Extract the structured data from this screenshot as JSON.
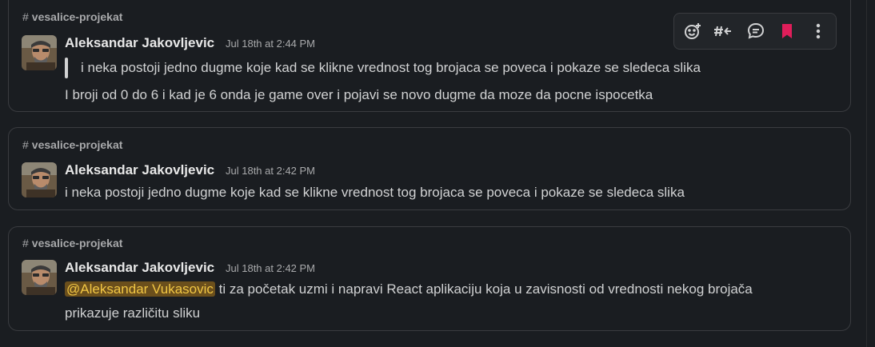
{
  "messages": [
    {
      "channel": "vesalice-projekat",
      "author": "Aleksandar Jakovljevic",
      "timestamp": "Jul 18th at 2:44 PM",
      "quote": "i neka postoji jedno dugme koje kad se klikne vrednost tog brojaca se poveca i pokaze se sledeca slika",
      "text": "I broji od 0 do 6 i kad je 6 onda je game over i pojavi se novo dugme da moze da pocne ispocetka"
    },
    {
      "channel": "vesalice-projekat",
      "author": "Aleksandar Jakovljevic",
      "timestamp": "Jul 18th at 2:42 PM",
      "text": "i neka postoji jedno dugme koje kad se klikne vrednost tog brojaca se poveca i pokaze se sledeca slika"
    },
    {
      "channel": "vesalice-projekat",
      "author": "Aleksandar Jakovljevic",
      "timestamp": "Jul 18th at 2:42 PM",
      "mention": "@Aleksandar Vukasovic",
      "text_line1": "ti za početak uzmi i napravi React aplikaciju koja u zavisnosti od vrednosti nekog brojača",
      "text_line2": "prikazuje različitu sliku"
    }
  ],
  "toolbar": {
    "icons": [
      "add-reaction-icon",
      "reply-in-channel-icon",
      "thread-reply-icon",
      "bookmark-icon",
      "more-actions-icon"
    ],
    "bookmark_color": "#e01e5a"
  },
  "colors": {
    "background": "#1a1d21",
    "mention_bg": "#6b4f1c",
    "mention_fg": "#f2c744"
  }
}
